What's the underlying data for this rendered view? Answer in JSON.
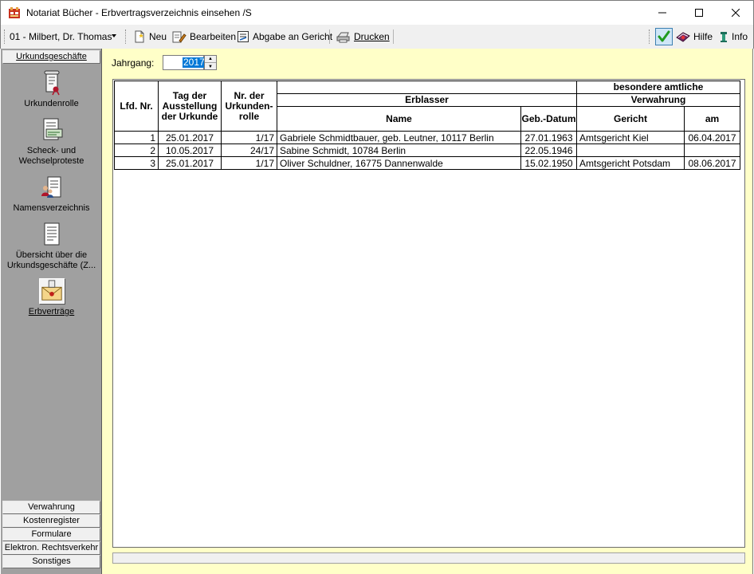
{
  "window": {
    "title": "Notariat Bücher - Erbvertragsverzeichnis einsehen /S"
  },
  "toolbar": {
    "notary": "01 - Milbert, Dr. Thomas",
    "neu": "Neu",
    "bearbeiten": "Bearbeiten",
    "abgabe": "Abgabe an Gericht",
    "drucken": "Drucken",
    "hilfe": "Hilfe",
    "info": "Info"
  },
  "sidebar": {
    "top_header": "Urkundsgeschäfte",
    "items": [
      {
        "label": "Urkundenrolle",
        "icon": "scroll-icon"
      },
      {
        "label": "Scheck- und Wechselproteste",
        "icon": "cheque-icon"
      },
      {
        "label": "Namensverzeichnis",
        "icon": "people-list-icon"
      },
      {
        "label": "Übersicht über die Urkundsgeschäfte (Z...",
        "icon": "document-list-icon"
      },
      {
        "label": "Erbverträge",
        "icon": "sealed-envelope-icon"
      }
    ],
    "bottom_headers": [
      "Verwahrung",
      "Kostenregister",
      "Formulare",
      "Elektron. Rechtsverkehr",
      "Sonstiges"
    ]
  },
  "filter": {
    "label": "Jahrgang:",
    "value": "2017"
  },
  "table": {
    "headers": {
      "lfd": "Lfd. Nr.",
      "tag": "Tag der Ausstellung der Urkunde",
      "nr": "Nr. der Urkunden-rolle",
      "group_top": "besondere amtliche",
      "erblasser": "Erblasser",
      "verwahrung": "Verwahrung",
      "name": "Name",
      "geb": "Geb.-Datum",
      "gericht": "Gericht",
      "am": "am"
    },
    "rows": [
      {
        "lfd": "1",
        "tag": "25.01.2017",
        "nr": "1/17",
        "name": "Gabriele Schmidtbauer, geb. Leutner, 10117 Berlin",
        "geb": "27.01.1963",
        "gericht": "Amtsgericht Kiel",
        "am": "06.04.2017"
      },
      {
        "lfd": "2",
        "tag": "10.05.2017",
        "nr": "24/17",
        "name": "Sabine Schmidt, 10784 Berlin",
        "geb": "22.05.1946",
        "gericht": "",
        "am": ""
      },
      {
        "lfd": "3",
        "tag": "25.01.2017",
        "nr": "1/17",
        "name": "Oliver Schuldner, 16775 Dannenwalde",
        "geb": "15.02.1950",
        "gericht": "Amtsgericht Potsdam",
        "am": "08.06.2017"
      }
    ]
  },
  "colors": {
    "main_bg": "#ffffc8",
    "sidebar_bg": "#a0a0a0",
    "selection": "#0078d7"
  }
}
